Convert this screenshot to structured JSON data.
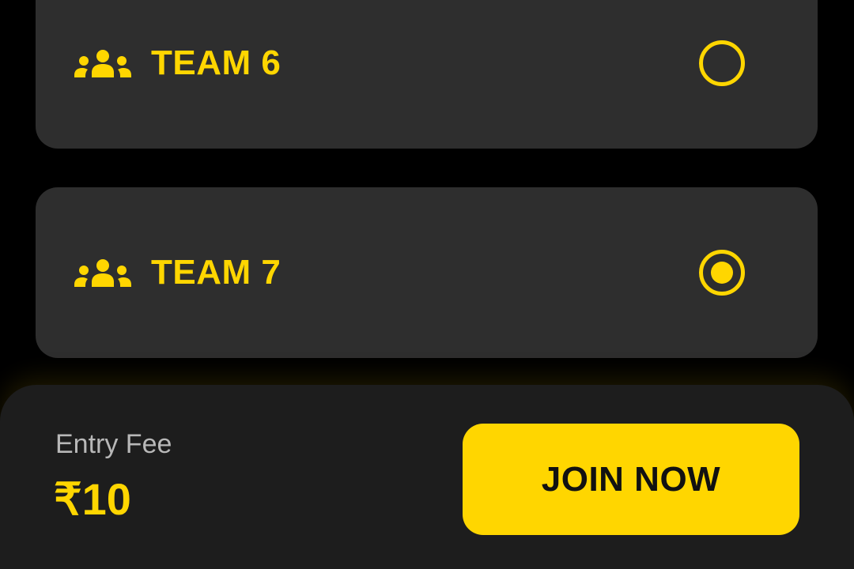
{
  "colors": {
    "accent": "#ffd600",
    "card_background": "#2e2e2e",
    "page_background": "#000000",
    "bottom_bar_background": "#1d1d1d",
    "muted_text": "#b8b8b8"
  },
  "teams": [
    {
      "label": "TEAM 6",
      "icon": "group-icon",
      "selected": false
    },
    {
      "label": "TEAM 7",
      "icon": "group-icon",
      "selected": true
    }
  ],
  "bottom_bar": {
    "fee_label": "Entry Fee",
    "fee_amount": "₹10",
    "join_button_label": "JOIN NOW"
  }
}
